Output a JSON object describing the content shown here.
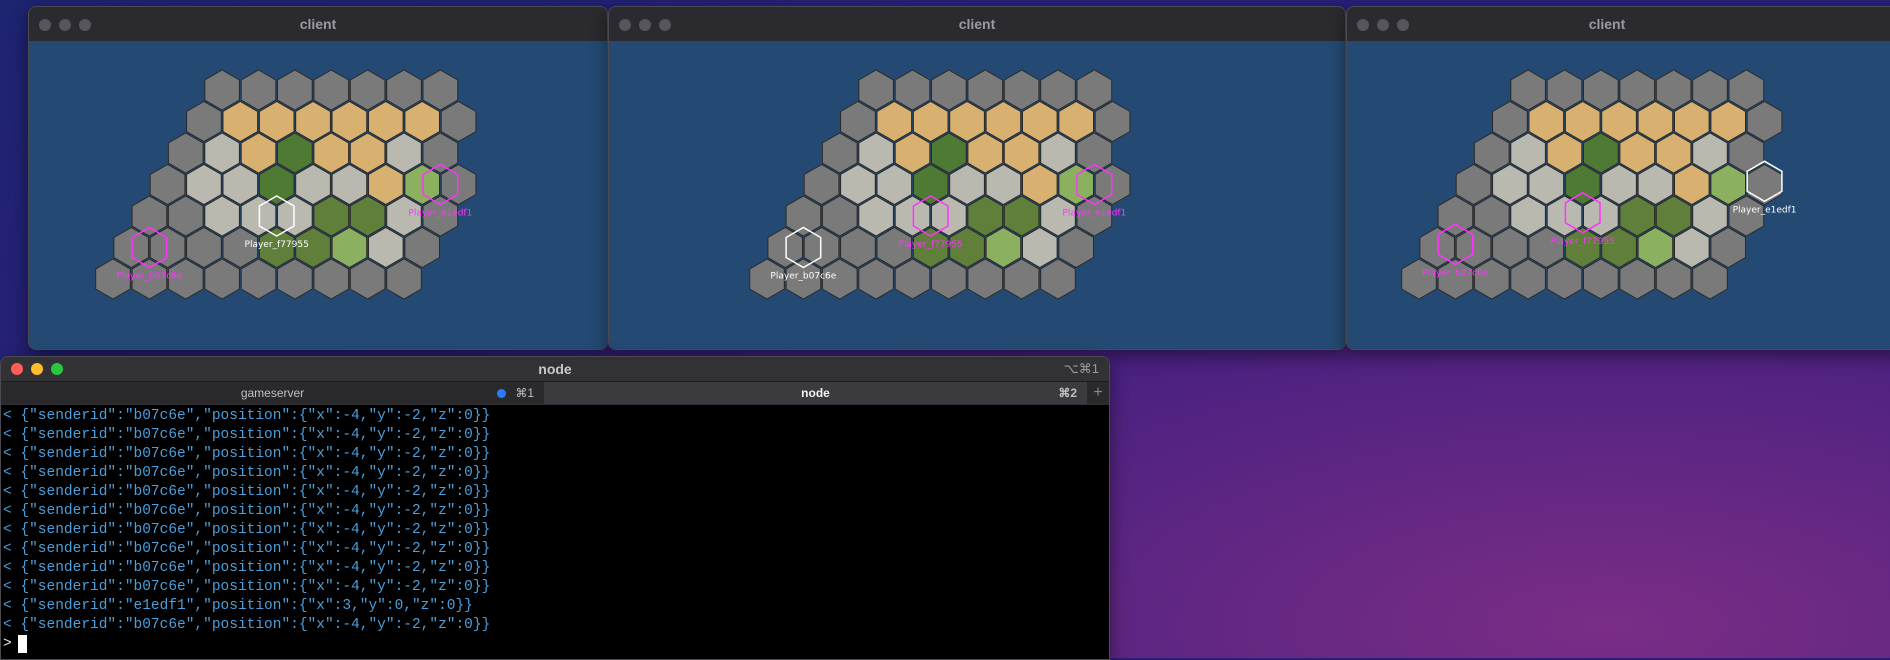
{
  "windows": [
    {
      "title": "client",
      "players": [
        {
          "label": "Player_e1edf1",
          "color": "#ff33ff",
          "self": false
        },
        {
          "label": "Player_f77955",
          "color": "#ffffff",
          "self": true
        },
        {
          "label": "Player_b07c6e",
          "color": "#ff33ff",
          "self": false
        }
      ]
    },
    {
      "title": "client",
      "players": [
        {
          "label": "Player_e1edf1",
          "color": "#ff33ff",
          "self": false
        },
        {
          "label": "Player_f77955",
          "color": "#ff33ff",
          "self": false
        },
        {
          "label": "Player_b07c6e",
          "color": "#ffffff",
          "self": true
        }
      ]
    },
    {
      "title": "client",
      "players": [
        {
          "label": "Player_e1edf1",
          "color": "#ffffff",
          "self": true
        },
        {
          "label": "Player_f77955",
          "color": "#ff33ff",
          "self": false
        },
        {
          "label": "Player_b07c6e",
          "color": "#ff33ff",
          "self": false
        }
      ]
    }
  ],
  "terminal": {
    "title": "node",
    "shortcut": "⌥⌘1",
    "tabs": [
      {
        "label": "gameserver",
        "shortcut": "⌘1",
        "active": false
      },
      {
        "label": "node",
        "shortcut": "⌘2",
        "active": true
      }
    ],
    "lines": [
      "< {\"senderid\":\"b07c6e\",\"position\":{\"x\":-4,\"y\":-2,\"z\":0}}",
      "< {\"senderid\":\"b07c6e\",\"position\":{\"x\":-4,\"y\":-2,\"z\":0}}",
      "< {\"senderid\":\"b07c6e\",\"position\":{\"x\":-4,\"y\":-2,\"z\":0}}",
      "< {\"senderid\":\"b07c6e\",\"position\":{\"x\":-4,\"y\":-2,\"z\":0}}",
      "< {\"senderid\":\"b07c6e\",\"position\":{\"x\":-4,\"y\":-2,\"z\":0}}",
      "< {\"senderid\":\"b07c6e\",\"position\":{\"x\":-4,\"y\":-2,\"z\":0}}",
      "< {\"senderid\":\"b07c6e\",\"position\":{\"x\":-4,\"y\":-2,\"z\":0}}",
      "< {\"senderid\":\"b07c6e\",\"position\":{\"x\":-4,\"y\":-2,\"z\":0}}",
      "< {\"senderid\":\"b07c6e\",\"position\":{\"x\":-4,\"y\":-2,\"z\":0}}",
      "< {\"senderid\":\"b07c6e\",\"position\":{\"x\":-4,\"y\":-2,\"z\":0}}",
      "< {\"senderid\":\"e1edf1\",\"position\":{\"x\":3,\"y\":0,\"z\":0}}",
      "< {\"senderid\":\"b07c6e\",\"position\":{\"x\":-4,\"y\":-2,\"z\":0}}"
    ],
    "prompt": ">"
  },
  "colors": {
    "ocean": "#244a73",
    "stone": "#7a7a7a",
    "sand": "#d8b070",
    "grass": "#8ab060",
    "forest": "#4f7a34",
    "rock": "#b9b9b0",
    "meadow": "#5f7f3a",
    "remote_player": "#ff33ff",
    "local_player": "#ffffff",
    "console_text": "#4a9fdc"
  }
}
